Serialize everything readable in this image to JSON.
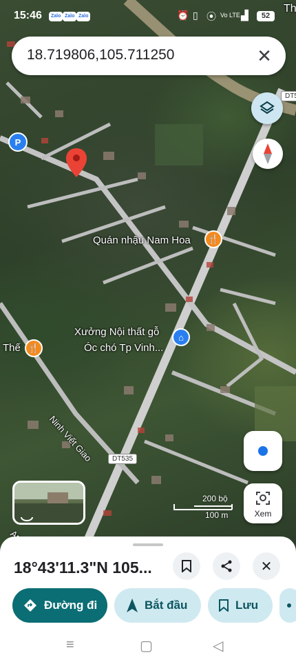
{
  "status_bar": {
    "time": "15:46",
    "zalo_label": "Zalo",
    "battery": "52",
    "network": "Vo LTE"
  },
  "search": {
    "value": "18.719806,105.711250"
  },
  "map": {
    "labels": {
      "quan_nhau": "Quán nhậu Nam Hoa",
      "xuong_line1": "Xưởng Nội thất gỗ",
      "xuong_line2": "Óc chó Tp Vinh...",
      "the": "Thế",
      "street": "Ninh Viết Giao",
      "road_dt535": "DT535",
      "road_dt5": "DT5",
      "top_right_text": "Th",
      "bottom_left_text": "Ap"
    },
    "scale": {
      "top": "200 bộ",
      "bottom": "100 m"
    },
    "xem_label": "Xem"
  },
  "sheet": {
    "coords": "18°43'11.3\"N 105...",
    "actions": {
      "directions": "Đường đi",
      "start": "Bắt đầu",
      "save": "Lưu"
    }
  },
  "colors": {
    "primary": "#0b6e74",
    "secondary": "#cfe9f0",
    "pin": "#ea4335",
    "poi_orange": "#f48a1e",
    "poi_blue": "#2a7ff0",
    "location_dot": "#1a73e8"
  }
}
